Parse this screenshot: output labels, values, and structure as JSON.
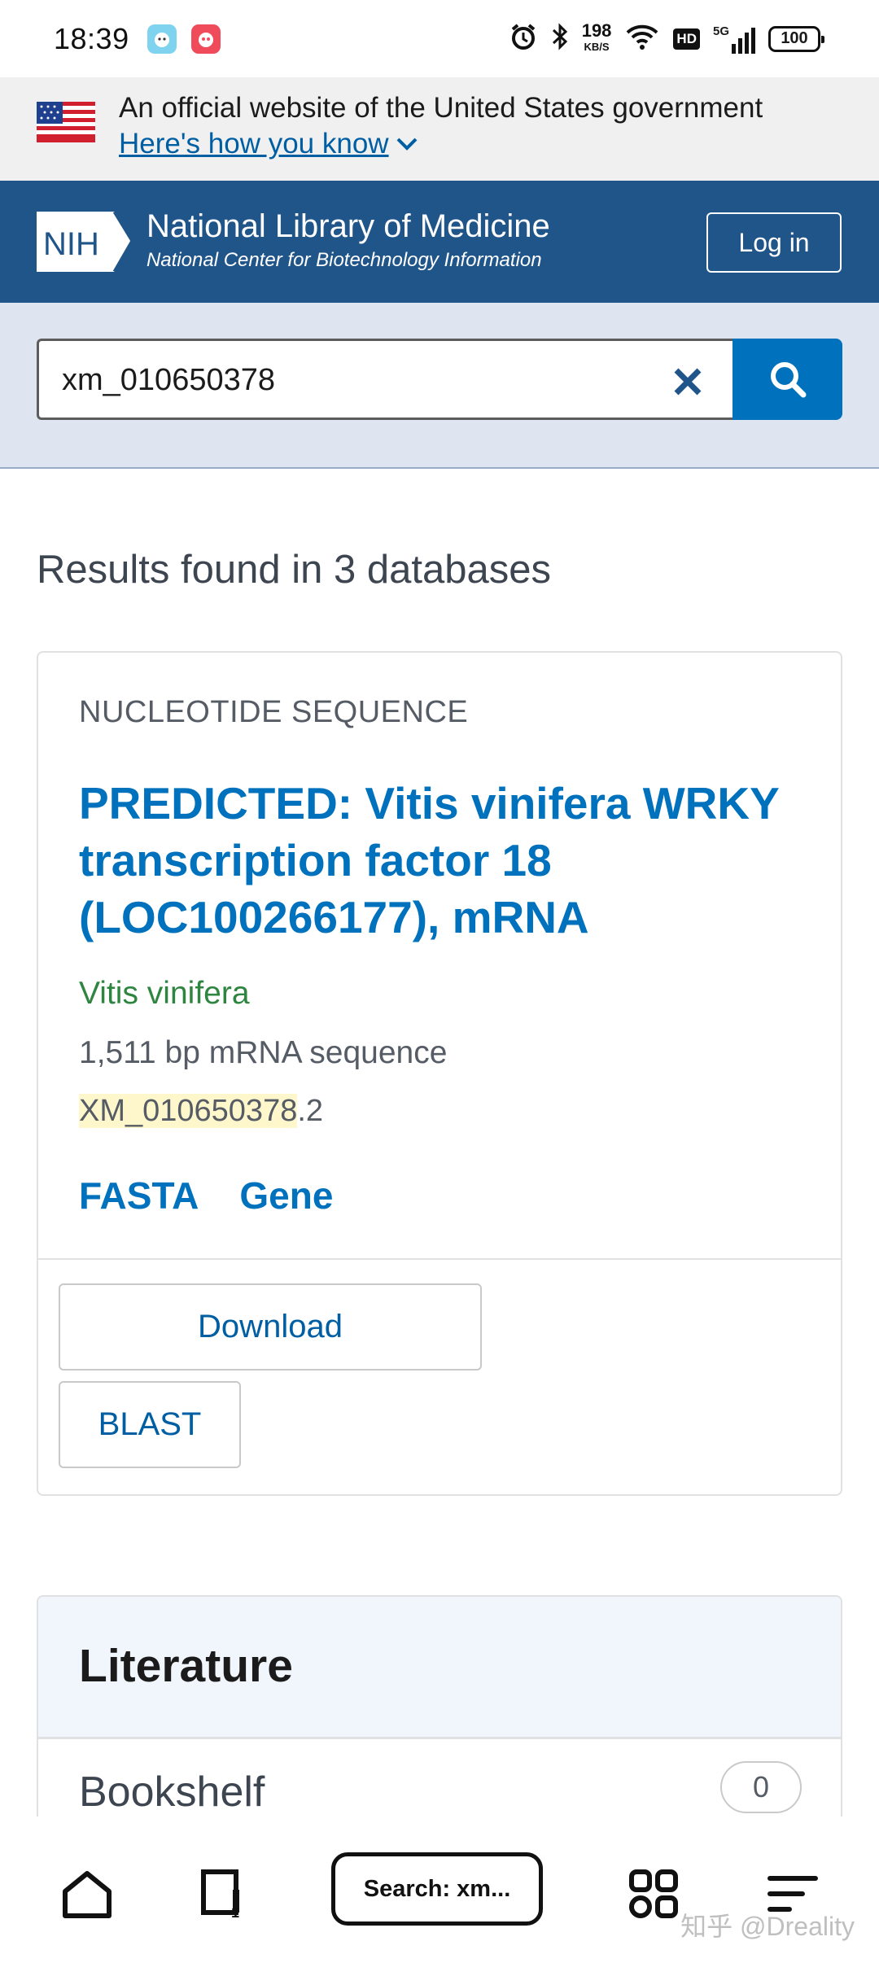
{
  "status_bar": {
    "time": "18:39",
    "net_speed_value": "198",
    "net_speed_unit": "KB/S",
    "hd_label": "HD",
    "network_label": "5G",
    "battery": "100"
  },
  "gov_banner": {
    "text": "An official website of the United States government",
    "link": "Here's how you know"
  },
  "header": {
    "logo_text": "NIH",
    "title": "National Library of Medicine",
    "subtitle": "National Center for Biotechnology Information",
    "login_label": "Log in"
  },
  "search": {
    "value": "xm_010650378"
  },
  "results": {
    "heading": "Results found in 3 databases"
  },
  "result_card": {
    "kicker": "NUCLEOTIDE SEQUENCE",
    "title": "PREDICTED: Vitis vinifera WRKY transcription factor 18 (LOC100266177), mRNA",
    "organism": "Vitis vinifera",
    "description": "1,511 bp mRNA sequence",
    "accession_match": "XM_010650378",
    "accession_version": ".2",
    "links": [
      "FASTA",
      "Gene"
    ],
    "download_label": "Download",
    "blast_label": "BLAST"
  },
  "literature": {
    "title": "Literature",
    "rows": [
      {
        "label": "Bookshelf",
        "count": "0"
      }
    ]
  },
  "bottom_nav": {
    "omnibox_label": "Search: xm..."
  },
  "watermark": "知乎 @Dreality",
  "colors": {
    "nlm_blue": "#20558a",
    "link_blue": "#0071bc",
    "organism_green": "#2e8540",
    "highlight": "#fff7cc"
  }
}
